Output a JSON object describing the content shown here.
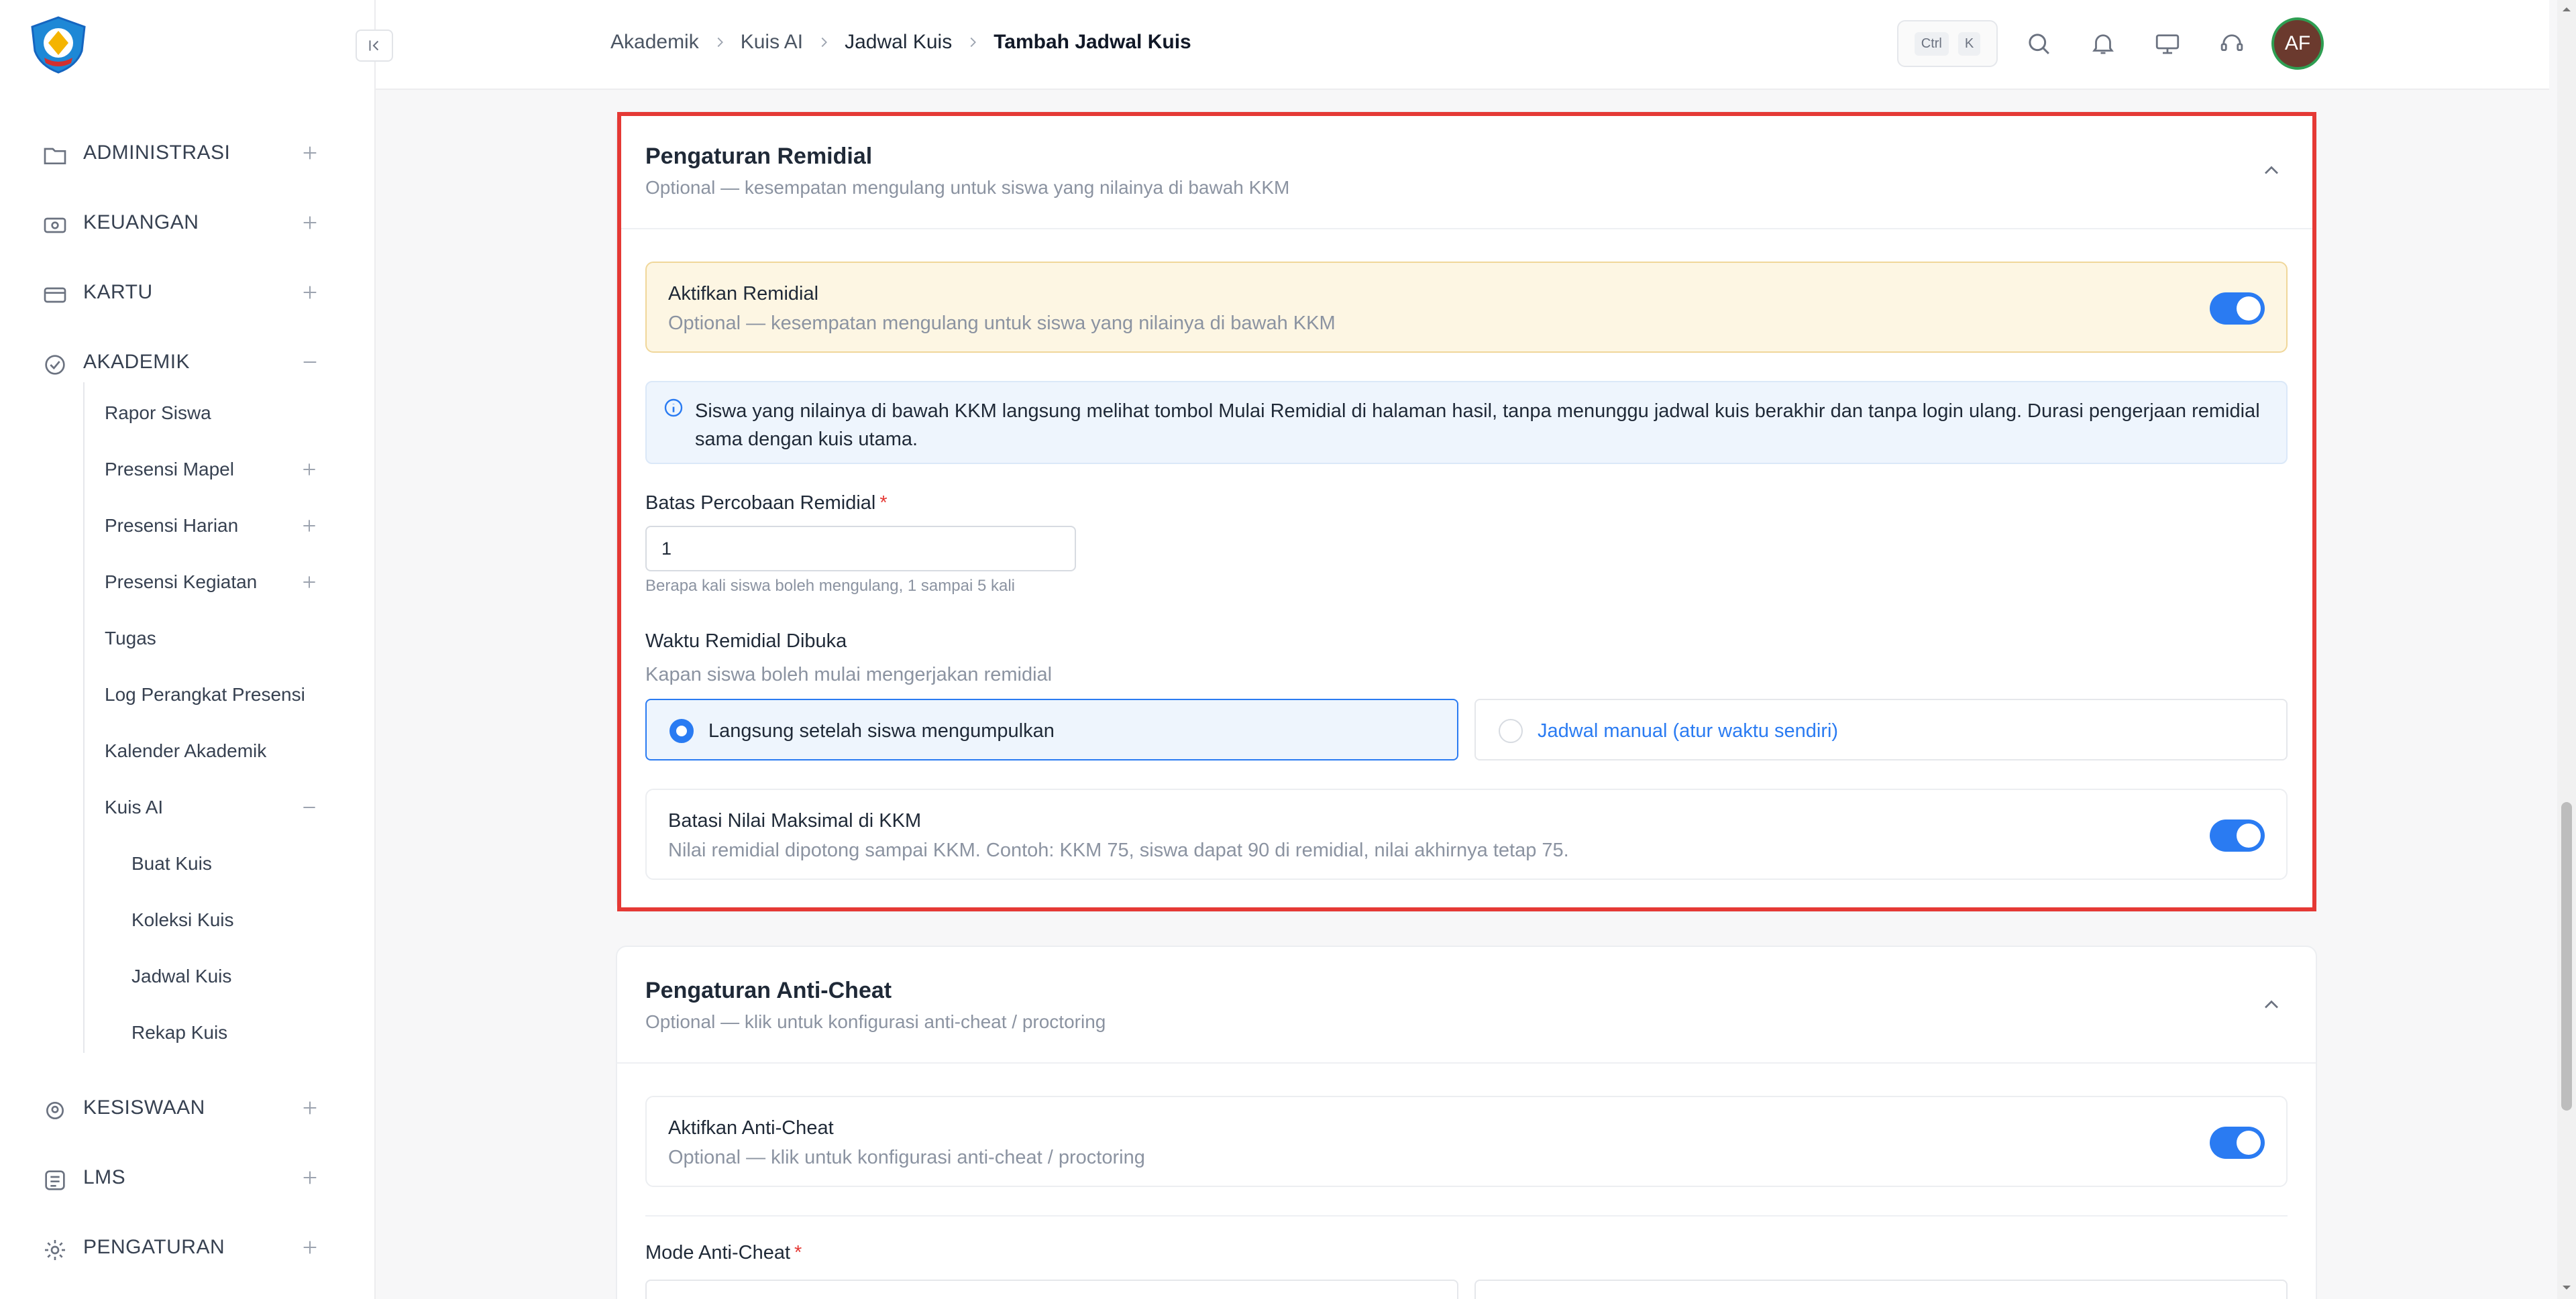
{
  "sidebar": {
    "top_items": [
      {
        "label": "ADMINISTRASI",
        "icon": "folder-icon",
        "toggle": "plus"
      },
      {
        "label": "KEUANGAN",
        "icon": "money-icon",
        "toggle": "plus"
      },
      {
        "label": "KARTU",
        "icon": "card-icon",
        "toggle": "plus"
      },
      {
        "label": "AKADEMIK",
        "icon": "academic-icon",
        "toggle": "minus"
      }
    ],
    "akademik_items": [
      {
        "label": "Rapor Siswa"
      },
      {
        "label": "Presensi Mapel",
        "toggle": "plus"
      },
      {
        "label": "Presensi Harian",
        "toggle": "plus"
      },
      {
        "label": "Presensi Kegiatan",
        "toggle": "plus"
      },
      {
        "label": "Tugas"
      },
      {
        "label": "Log Perangkat Presensi"
      },
      {
        "label": "Kalender Akademik"
      },
      {
        "label": "Kuis AI",
        "toggle": "minus"
      }
    ],
    "kuis_items": [
      {
        "label": "Buat Kuis"
      },
      {
        "label": "Koleksi Kuis"
      },
      {
        "label": "Jadwal Kuis"
      },
      {
        "label": "Rekap Kuis"
      }
    ],
    "bottom_items": [
      {
        "label": "KESISWAAN",
        "icon": "student-icon",
        "toggle": "plus"
      },
      {
        "label": "LMS",
        "icon": "lms-icon",
        "toggle": "plus"
      },
      {
        "label": "PENGATURAN",
        "icon": "gear-icon",
        "toggle": "plus"
      }
    ]
  },
  "header": {
    "breadcrumb": [
      "Akademik",
      "Kuis AI",
      "Jadwal Kuis",
      "Tambah Jadwal Kuis"
    ],
    "shortcut": {
      "key1": "Ctrl",
      "key2": "K"
    },
    "avatar_initials": "AF"
  },
  "remedial": {
    "title": "Pengaturan Remidial",
    "subtitle": "Optional — kesempatan mengulang untuk siswa yang nilainya di bawah KKM",
    "enable": {
      "title": "Aktifkan Remidial",
      "subtitle": "Optional — kesempatan mengulang untuk siswa yang nilainya di bawah KKM",
      "on": true
    },
    "info_text": "Siswa yang nilainya di bawah KKM langsung melihat tombol Mulai Remidial di halaman hasil, tanpa menunggu jadwal kuis berakhir dan tanpa login ulang. Durasi pengerjaan remidial sama dengan kuis utama.",
    "attempts": {
      "label": "Batas Percobaan Remidial",
      "required_mark": "*",
      "value": "1",
      "hint": "Berapa kali siswa boleh mengulang, 1 sampai 5 kali"
    },
    "open_time": {
      "label": "Waktu Remidial Dibuka",
      "description": "Kapan siswa boleh mulai mengerjakan remidial",
      "options": [
        {
          "label": "Langsung setelah siswa mengumpulkan",
          "selected": true
        },
        {
          "label": "Jadwal manual (atur waktu sendiri)",
          "selected": false
        }
      ]
    },
    "cap": {
      "title": "Batasi Nilai Maksimal di KKM",
      "subtitle": "Nilai remidial dipotong sampai KKM. Contoh: KKM 75, siswa dapat 90 di remidial, nilai akhirnya tetap 75.",
      "on": true
    }
  },
  "anticheat": {
    "title": "Pengaturan Anti-Cheat",
    "subtitle": "Optional — klik untuk konfigurasi anti-cheat / proctoring",
    "enable": {
      "title": "Aktifkan Anti-Cheat",
      "subtitle": "Optional — klik untuk konfigurasi anti-cheat / proctoring",
      "on": true
    },
    "mode_label": "Mode Anti-Cheat",
    "required_mark": "*"
  },
  "colors": {
    "accent": "#2a7bf2",
    "highlight": "#e53935",
    "warning_bg": "#fdf6e3",
    "info_bg": "#eef5fd"
  }
}
